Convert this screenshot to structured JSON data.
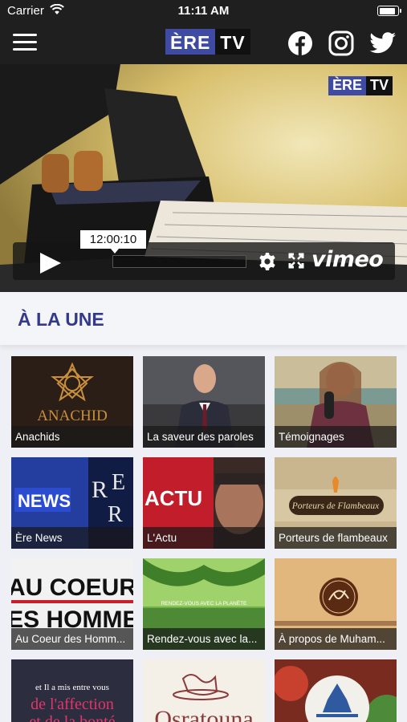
{
  "status_bar": {
    "carrier": "Carrier",
    "time": "11:11 AM",
    "battery_level": 0.95
  },
  "nav": {
    "logo_part1": "ÈRE",
    "logo_part2": "TV"
  },
  "social": [
    {
      "name": "facebook",
      "icon": "facebook-icon"
    },
    {
      "name": "instagram",
      "icon": "instagram-icon"
    },
    {
      "name": "twitter",
      "icon": "twitter-icon"
    }
  ],
  "video": {
    "watermark_part1": "ÈRE",
    "watermark_part2": "TV",
    "timecode": "12:00:10",
    "vimeo_label": "vimeo"
  },
  "section": {
    "title": "À LA UNE"
  },
  "tiles": [
    {
      "label": "Anachids",
      "art_text": "ANACHID"
    },
    {
      "label": "La saveur des paroles"
    },
    {
      "label": "Témoignages"
    },
    {
      "label": "Ère News",
      "art_text": "NEWS"
    },
    {
      "label": "L'Actu",
      "art_text": "ACTU"
    },
    {
      "label": "Porteurs de flambeaux",
      "art_text": "Porteurs de Flambeaux"
    },
    {
      "label": "Au Coeur des Homm...",
      "art_text_1": "AU COEUR",
      "art_text_2": "DES HOMMES"
    },
    {
      "label": "Rendez-vous avec la...",
      "art_text": "RENDEZ-VOUS AVEC LA PLANÈTE"
    },
    {
      "label": "À propos de Muham..."
    },
    {
      "label": "",
      "art_text_1": "et Il a mis entre vous",
      "art_text_2": "de l'affection",
      "art_text_3": "et de la bonté"
    },
    {
      "label": "",
      "art_text": "Qsratouna"
    },
    {
      "label": ""
    }
  ],
  "colors": {
    "bar_bg": "#1f1f1f",
    "brand_blue": "#3f4aa3",
    "section_title": "#34398a"
  }
}
